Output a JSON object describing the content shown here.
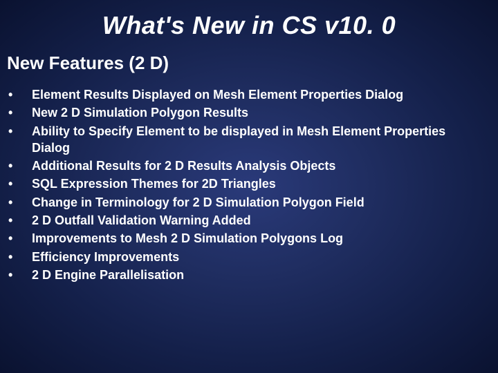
{
  "slide": {
    "title": "What's New in CS v10. 0",
    "subtitle": "New Features (2 D)",
    "bullets": [
      "Element Results Displayed on Mesh Element Properties Dialog",
      "New 2 D Simulation Polygon Results",
      "Ability to Specify Element to be displayed in Mesh Element Properties Dialog",
      "Additional Results for 2 D Results Analysis Objects",
      "SQL Expression Themes for 2D Triangles",
      "Change in Terminology for 2 D Simulation Polygon Field",
      "2 D Outfall Validation Warning Added",
      "Improvements to Mesh 2 D Simulation Polygons Log",
      "Efficiency Improvements",
      "2 D Engine Parallelisation"
    ]
  }
}
